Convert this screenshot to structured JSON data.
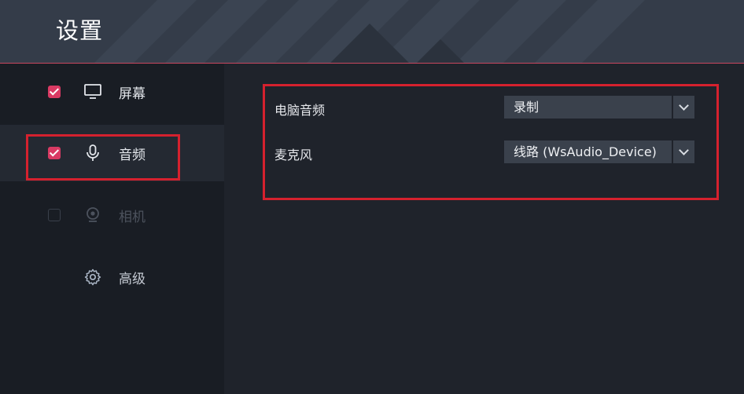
{
  "header": {
    "title": "设置"
  },
  "sidebar": {
    "items": [
      {
        "id": "screen",
        "label": "屏幕",
        "checked": true,
        "icon": "monitor-icon"
      },
      {
        "id": "audio",
        "label": "音频",
        "checked": true,
        "icon": "microphone-icon",
        "selected": true
      },
      {
        "id": "camera",
        "label": "相机",
        "checked": false,
        "icon": "webcam-icon",
        "disabled": true
      },
      {
        "id": "advanced",
        "label": "高级",
        "icon": "gear-icon"
      }
    ]
  },
  "audio": {
    "computer_audio": {
      "label": "电脑音频",
      "value": "录制"
    },
    "microphone": {
      "label": "麦克风",
      "value": "线路 (WsAudio_Device)"
    }
  },
  "colors": {
    "accent": "#d93a63",
    "highlight": "#d5212e"
  }
}
